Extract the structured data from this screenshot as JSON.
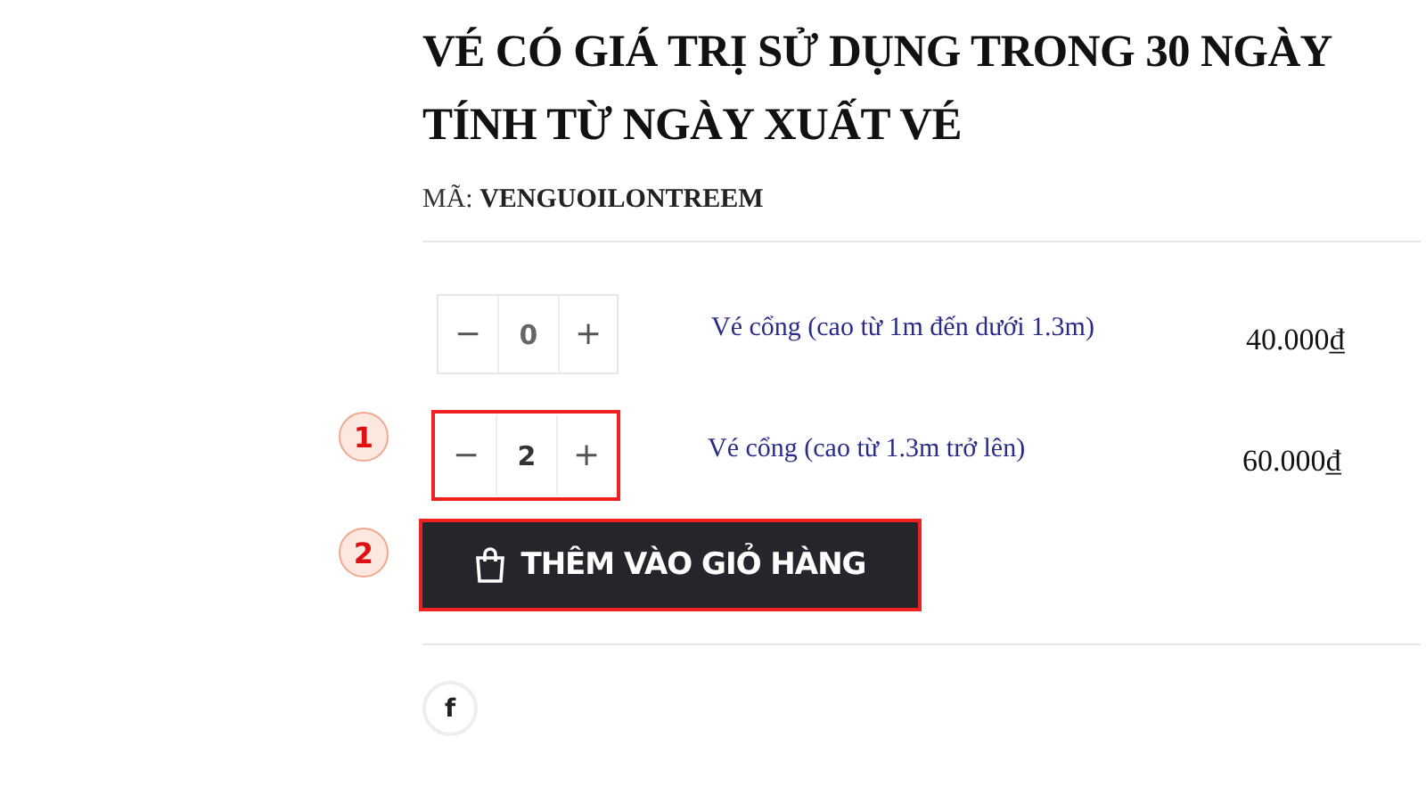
{
  "title": "VÉ CÓ GIÁ TRỊ SỬ DỤNG TRONG 30 NGÀY TÍNH TỪ NGÀY XUẤT VÉ",
  "sku": {
    "label": "MÃ:",
    "value": "VENGUOILONTREEM"
  },
  "tickets": [
    {
      "minus": "−",
      "quantity": "0",
      "plus": "+",
      "name": "Vé cổng (cao từ 1m đến dưới 1.3m)",
      "price": "40.000₫",
      "highlighted": false
    },
    {
      "minus": "−",
      "quantity": "2",
      "plus": "+",
      "name": "Vé cổng (cao từ 1.3m trở lên)",
      "price": "60.000₫",
      "highlighted": true,
      "marker": "1"
    }
  ],
  "add_to_cart": {
    "label": "THÊM VÀO GIỎ HÀNG",
    "highlighted": true,
    "marker": "2"
  },
  "share": [
    {
      "kind": "facebook",
      "glyph": "f"
    }
  ]
}
